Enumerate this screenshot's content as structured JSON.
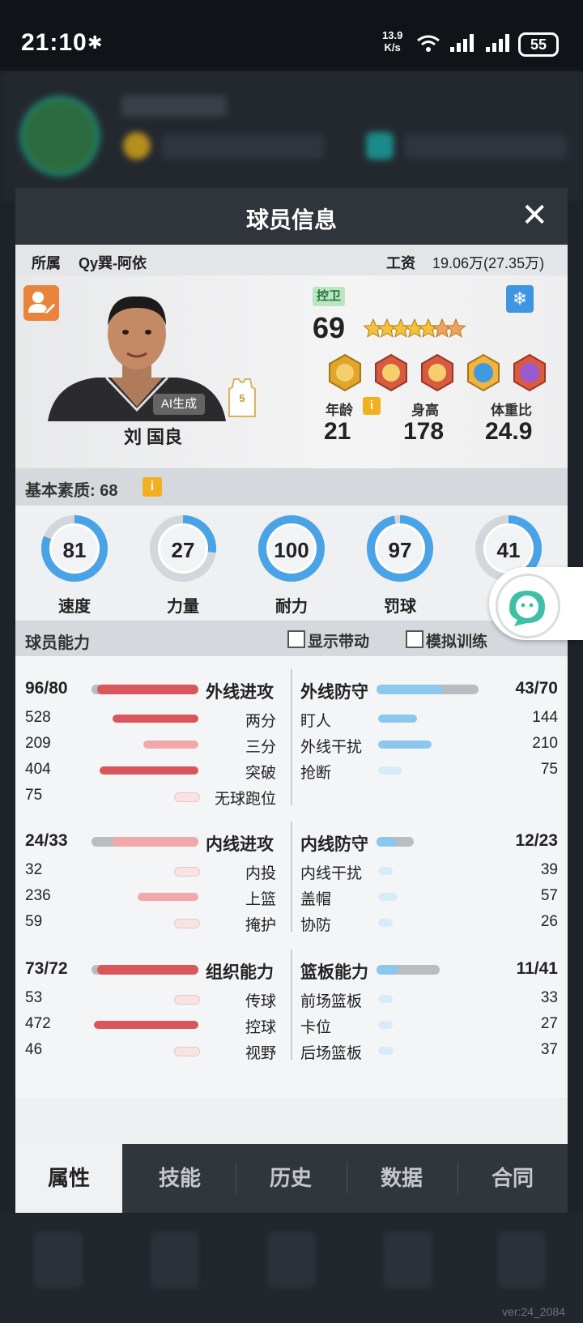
{
  "status_bar": {
    "time": "21:10",
    "net_speed_top": "13.9",
    "net_speed_bottom": "K/s",
    "battery": "55"
  },
  "modal": {
    "title": "球员信息",
    "close": "✕",
    "team_label": "所属",
    "team_value": "Qy巽-阿依",
    "salary_label": "工资",
    "salary_value": "19.06万(27.35万)"
  },
  "player": {
    "name": "刘 国良",
    "ai_tag": "AI生成",
    "jersey": "5",
    "position": "控卫",
    "rating": "69",
    "stars_filled": 5,
    "stars_total": 7,
    "age_label": "年龄",
    "age": "21",
    "height_label": "身高",
    "height": "178",
    "ratio_label": "体重比",
    "ratio": "24.9",
    "badge_icons": [
      "gold-badge-icon",
      "red-badge-icon",
      "red-badge-icon",
      "blue-badge-icon",
      "purple-badge-icon"
    ]
  },
  "basic": {
    "label": "基本素质: 68",
    "info": "i",
    "gauges": [
      {
        "label": "速度",
        "value": "81",
        "percent": 81
      },
      {
        "label": "力量",
        "value": "27",
        "percent": 27
      },
      {
        "label": "耐力",
        "value": "100",
        "percent": 100
      },
      {
        "label": "罚球",
        "value": "97",
        "percent": 97
      },
      {
        "label": "",
        "value": "41",
        "percent": 41
      }
    ]
  },
  "ability": {
    "label": "球员能力",
    "show_drive": "显示带动",
    "simulate_training": "模拟训练"
  },
  "groups": [
    {
      "left": {
        "name": "外线进攻",
        "score": "96/80",
        "fill": 0.95,
        "items": [
          {
            "name": "两分",
            "value": "528",
            "fill": 0.78
          },
          {
            "name": "三分",
            "value": "209",
            "fill": 0.5
          },
          {
            "name": "突破",
            "value": "404",
            "fill": 0.9
          },
          {
            "name": "无球跑位",
            "value": "75",
            "fill": 0.22
          }
        ]
      },
      "right": {
        "name": "外线防守",
        "score": "43/70",
        "fill": 0.65,
        "items": [
          {
            "name": "盯人",
            "value": "144",
            "fill": 0.4
          },
          {
            "name": "外线干扰",
            "value": "210",
            "fill": 0.55
          },
          {
            "name": "抢断",
            "value": "75",
            "fill": 0.25
          }
        ]
      }
    },
    {
      "left": {
        "name": "内线进攻",
        "score": "24/33",
        "fill": 0.8,
        "items": [
          {
            "name": "内投",
            "value": "32",
            "fill": 0.15
          },
          {
            "name": "上篮",
            "value": "236",
            "fill": 0.55
          },
          {
            "name": "掩护",
            "value": "59",
            "fill": 0.2
          }
        ]
      },
      "right": {
        "name": "内线防守",
        "score": "12/23",
        "fill": 0.55,
        "items": [
          {
            "name": "内线干扰",
            "value": "39",
            "fill": 0.15
          },
          {
            "name": "盖帽",
            "value": "57",
            "fill": 0.2
          },
          {
            "name": "协防",
            "value": "26",
            "fill": 0.12
          }
        ]
      }
    },
    {
      "left": {
        "name": "组织能力",
        "score": "73/72",
        "fill": 0.95,
        "items": [
          {
            "name": "传球",
            "value": "53",
            "fill": 0.18
          },
          {
            "name": "控球",
            "value": "472",
            "fill": 0.95
          },
          {
            "name": "视野",
            "value": "46",
            "fill": 0.17
          }
        ]
      },
      "right": {
        "name": "篮板能力",
        "score": "11/41",
        "fill": 0.35,
        "items": [
          {
            "name": "前场篮板",
            "value": "33",
            "fill": 0.15
          },
          {
            "name": "卡位",
            "value": "27",
            "fill": 0.13
          },
          {
            "name": "后场篮板",
            "value": "37",
            "fill": 0.16
          }
        ]
      }
    }
  ],
  "tabs": [
    "属性",
    "技能",
    "历史",
    "数据",
    "合同"
  ],
  "active_tab": 0,
  "version": "ver:24_2084",
  "colors": {
    "attack_bar": "#d9575b",
    "attack_bar_light": "#f2a8ab",
    "defense_bar": "#8cc8ee",
    "gauge_ring": "#4aa3e6",
    "header": "#30353c"
  }
}
